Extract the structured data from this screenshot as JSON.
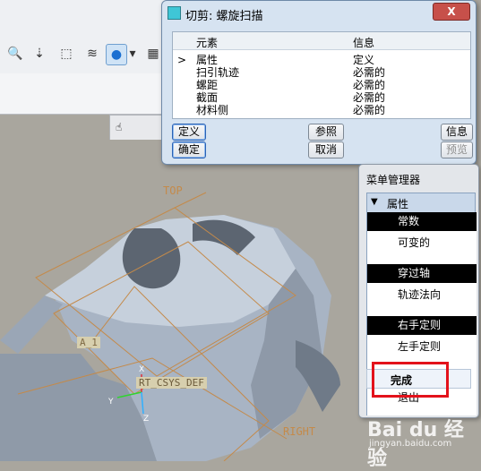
{
  "dialog": {
    "title": "切剪: 螺旋扫描",
    "close_label": "X",
    "columns": [
      "元素",
      "信息"
    ],
    "rows": [
      {
        "marker": ">",
        "element": "属性",
        "info": "定义"
      },
      {
        "marker": "",
        "element": "扫引轨迹",
        "info": "必需的"
      },
      {
        "marker": "",
        "element": "螺距",
        "info": "必需的"
      },
      {
        "marker": "",
        "element": "截面",
        "info": "必需的"
      },
      {
        "marker": "",
        "element": "材料侧",
        "info": "必需的"
      }
    ],
    "buttons": {
      "define": "定义",
      "reference": "参照",
      "info": "信息",
      "ok": "确定",
      "cancel": "取消",
      "preview": "预览"
    }
  },
  "menu_manager": {
    "title": "菜单管理器",
    "section": "属性",
    "items": [
      {
        "label": "常数",
        "selected": true
      },
      {
        "label": "可变的",
        "selected": false
      },
      {
        "label": "穿过轴",
        "selected": true
      },
      {
        "label": "轨迹法向",
        "selected": false
      },
      {
        "label": "右手定则",
        "selected": true
      },
      {
        "label": "左手定则",
        "selected": false
      }
    ],
    "done": "完成",
    "exit": "退出"
  },
  "viewport": {
    "datum_labels": {
      "top": "TOP",
      "right": "RIGHT",
      "axis": "A_1",
      "csys": "RT_CSYS_DEF"
    },
    "axis_letters": {
      "x": "X",
      "y": "Y",
      "z": "Z"
    }
  },
  "toolbar": {
    "icons": [
      "zoom-icon",
      "datum-plane-icon",
      "datum-axis-icon",
      "layers-icon",
      "sphere-icon",
      "dropdown-icon",
      "model-tree-icon"
    ]
  },
  "watermark": {
    "brand": "Bai du 经验",
    "url": "jingyan.baidu.com"
  },
  "colors": {
    "highlight": "#e3121b",
    "datum": "#c48a4a",
    "part": "#a7b3c3",
    "selected_bg": "#000000"
  }
}
